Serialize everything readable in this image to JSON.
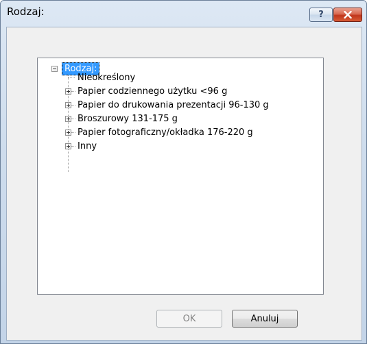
{
  "window": {
    "title": "Rodzaj:",
    "help_symbol": "?"
  },
  "tree": {
    "root_label": "Rodzaj:",
    "items": [
      {
        "label": "Nieokreślony",
        "expandable": false
      },
      {
        "label": "Papier codziennego użytku <96 g",
        "expandable": true
      },
      {
        "label": "Papier do drukowania prezentacji 96-130 g",
        "expandable": true
      },
      {
        "label": "Broszurowy 131-175 g",
        "expandable": true
      },
      {
        "label": "Papier fotograficzny/okładka 176-220 g",
        "expandable": true
      },
      {
        "label": "Inny",
        "expandable": true
      }
    ]
  },
  "buttons": {
    "ok_label": "OK",
    "cancel_label": "Anuluj"
  },
  "colors": {
    "selection": "#3399ff",
    "close_button": "#c7432a",
    "disabled_text": "#838383"
  }
}
